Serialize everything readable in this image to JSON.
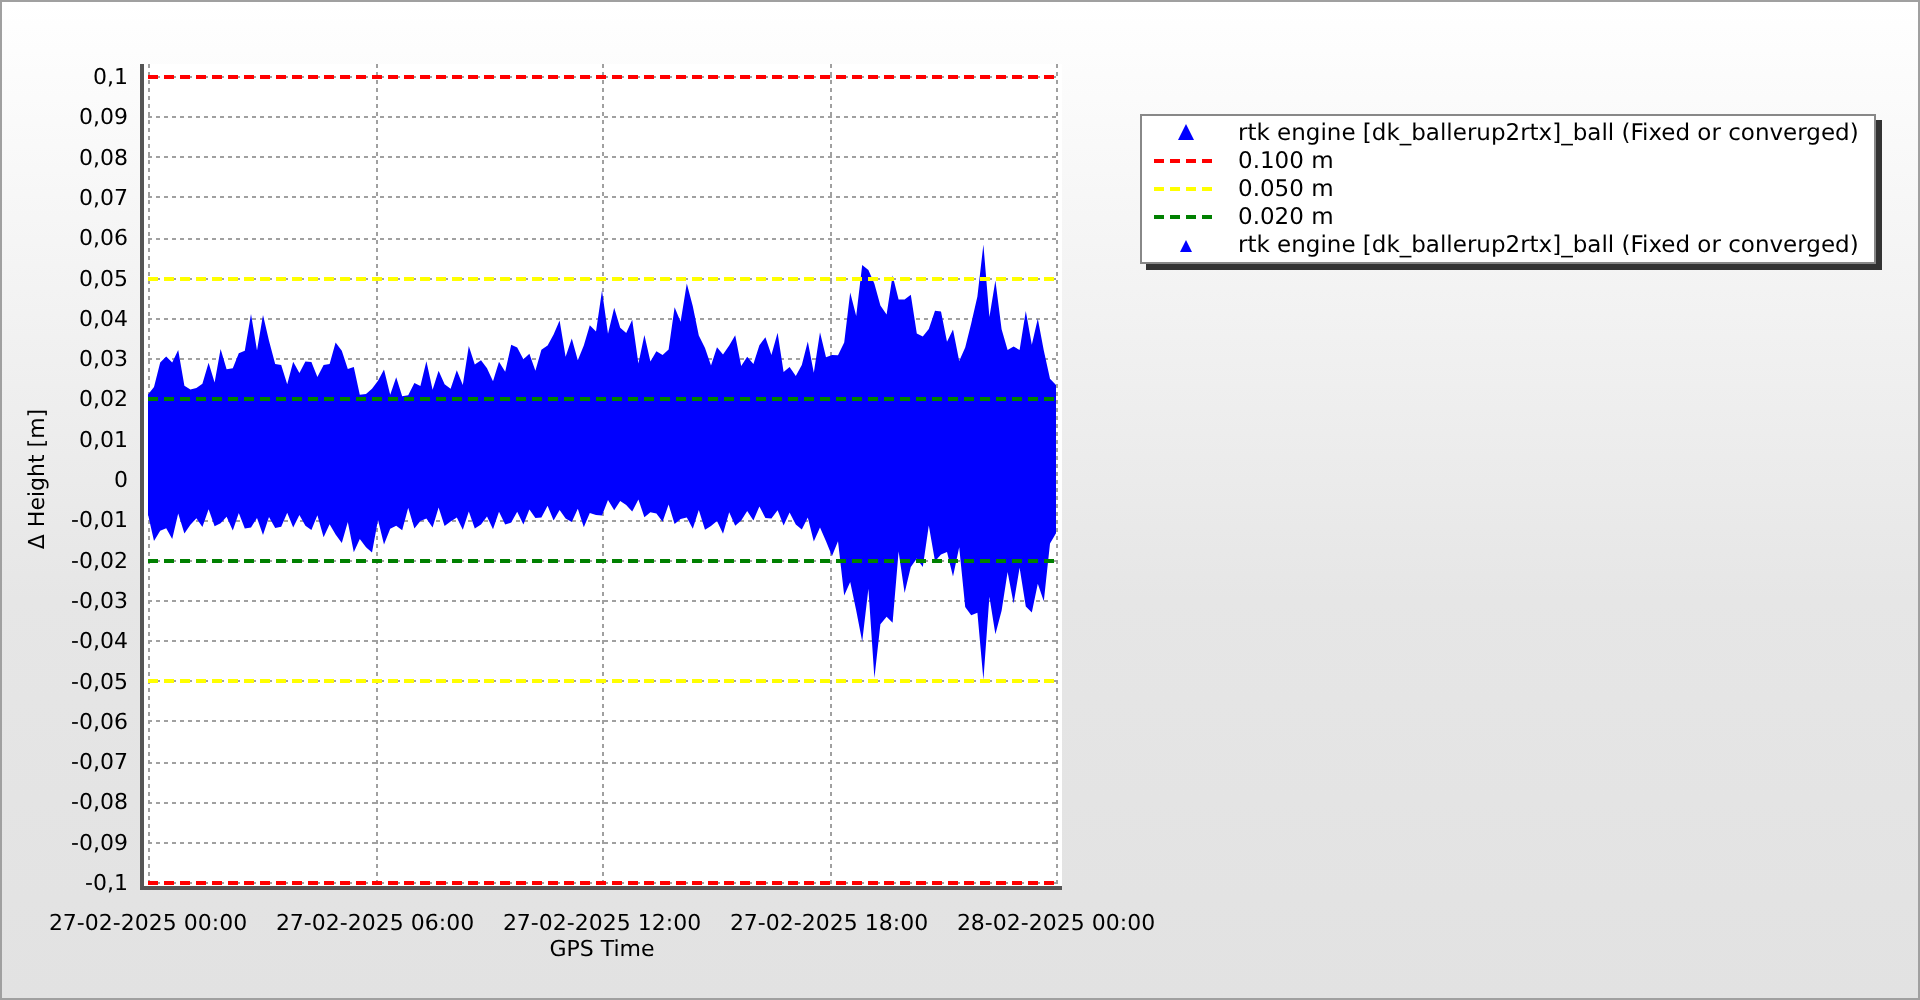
{
  "chart": {
    "chart_data": {
      "type": "line",
      "xlabel": "GPS Time",
      "ylabel": "Δ Height [m]",
      "categories": [
        "27-02-2025 00:00",
        "27-02-2025 06:00",
        "27-02-2025 12:00",
        "27-02-2025 18:00",
        "28-02-2025 00:00"
      ],
      "ylim": [
        -0.1,
        0.1
      ],
      "yticks": [
        {
          "value": 0.1,
          "label": "0,1"
        },
        {
          "value": 0.09,
          "label": "0,09"
        },
        {
          "value": 0.08,
          "label": "0,08"
        },
        {
          "value": 0.07,
          "label": "0,07"
        },
        {
          "value": 0.06,
          "label": "0,06"
        },
        {
          "value": 0.05,
          "label": "0,05"
        },
        {
          "value": 0.04,
          "label": "0,04"
        },
        {
          "value": 0.03,
          "label": "0,03"
        },
        {
          "value": 0.02,
          "label": "0,02"
        },
        {
          "value": 0.01,
          "label": "0,01"
        },
        {
          "value": 0,
          "label": "0"
        },
        {
          "value": -0.01,
          "label": "-0,01"
        },
        {
          "value": -0.02,
          "label": "-0,02"
        },
        {
          "value": -0.03,
          "label": "-0,03"
        },
        {
          "value": -0.04,
          "label": "-0,04"
        },
        {
          "value": -0.05,
          "label": "-0,05"
        },
        {
          "value": -0.06,
          "label": "-0,06"
        },
        {
          "value": -0.07,
          "label": "-0,07"
        },
        {
          "value": -0.08,
          "label": "-0,08"
        },
        {
          "value": -0.09,
          "label": "-0,09"
        },
        {
          "value": -0.1,
          "label": "-0,1"
        }
      ],
      "grid": true,
      "series": [
        {
          "name": "0.100 m",
          "color": "#ff0000",
          "line_style": "dashed",
          "values": [
            0.1,
            0.1,
            0.1,
            0.1,
            0.1
          ]
        },
        {
          "name": "0.050 m",
          "color": "#ffff00",
          "line_style": "dashed",
          "values": [
            0.05,
            0.05,
            0.05,
            0.05,
            0.05
          ]
        },
        {
          "name": "0.020 m",
          "color": "#008000",
          "line_style": "dashed",
          "values": [
            0.02,
            0.02,
            0.02,
            0.02,
            0.02
          ]
        },
        {
          "color": "#ff0000",
          "line_style": "dashed",
          "values": [
            -0.1,
            -0.1,
            -0.1,
            -0.1,
            -0.1
          ]
        },
        {
          "color": "#ffff00",
          "line_style": "dashed",
          "values": [
            -0.05,
            -0.05,
            -0.05,
            -0.05,
            -0.05
          ]
        },
        {
          "color": "#008000",
          "line_style": "dashed",
          "values": [
            -0.02,
            -0.02,
            -0.02,
            -0.02,
            -0.02
          ]
        }
      ]
    }
  },
  "legend": [
    {
      "kind": "bigmarker",
      "color": "#0000ff",
      "label": "rtk engine [dk_ballerup2rtx]_ball (Fixed or converged)"
    },
    {
      "kind": "smallmarker",
      "color": "#0000ff",
      "label": "rtk engine [dk_ballerup2rtx]_ball (Fixed or converged)"
    }
  ]
}
